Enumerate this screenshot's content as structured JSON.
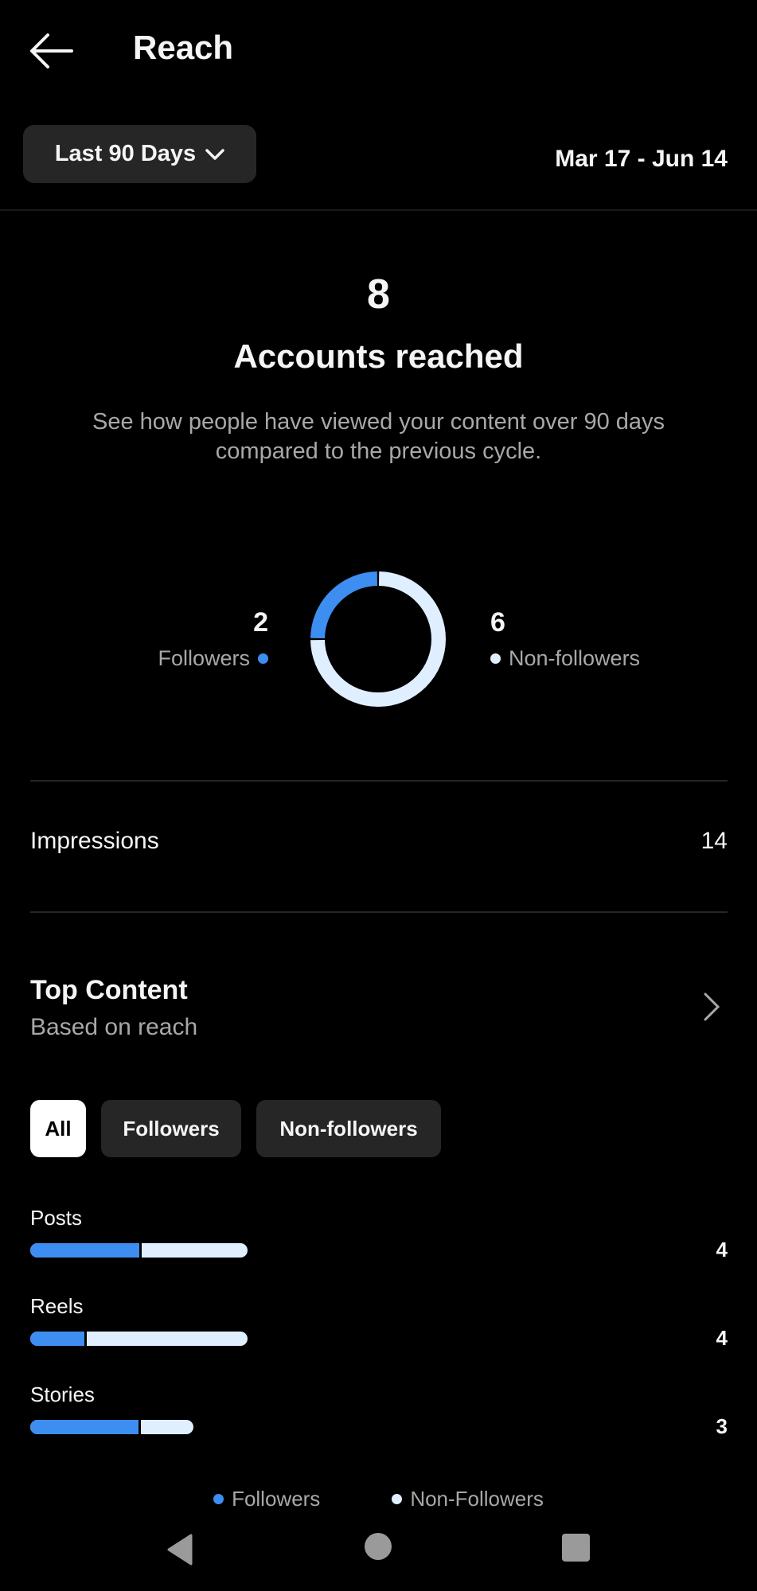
{
  "header": {
    "title": "Reach",
    "back_icon": "arrow-left-icon"
  },
  "filter": {
    "range_label": "Last 90 Days",
    "date_range": "Mar 17 - Jun 14"
  },
  "summary": {
    "total": "8",
    "label": "Accounts reached",
    "description": "See how people have viewed your content over 90 days compared to the previous cycle."
  },
  "colors": {
    "followers": "#3d8ef0",
    "non_followers": "#e0efff",
    "background": "#000000"
  },
  "chart_data": [
    {
      "type": "pie",
      "title": "Accounts reached",
      "categories": [
        "Followers",
        "Non-followers"
      ],
      "values": [
        2,
        6
      ]
    },
    {
      "type": "bar",
      "title": "Top Content",
      "categories": [
        "Posts",
        "Reels",
        "Stories"
      ],
      "series": [
        {
          "name": "Followers",
          "values": [
            2,
            1,
            2
          ]
        },
        {
          "name": "Non-Followers",
          "values": [
            2,
            3,
            1
          ]
        }
      ],
      "totals": [
        4,
        4,
        3
      ],
      "legend": "bottom"
    }
  ],
  "donut": {
    "followers": {
      "value": "2",
      "label": "Followers"
    },
    "non_followers": {
      "value": "6",
      "label": "Non-followers"
    }
  },
  "impressions": {
    "label": "Impressions",
    "value": "14"
  },
  "top_content": {
    "title": "Top Content",
    "subtitle": "Based on reach",
    "tabs": [
      {
        "label": "All",
        "active": true
      },
      {
        "label": "Followers",
        "active": false
      },
      {
        "label": "Non-followers",
        "active": false
      }
    ],
    "rows": [
      {
        "label": "Posts",
        "followers": 2,
        "non_followers": 2,
        "total": "4"
      },
      {
        "label": "Reels",
        "followers": 1,
        "non_followers": 3,
        "total": "4"
      },
      {
        "label": "Stories",
        "followers": 2,
        "non_followers": 1,
        "total": "3"
      }
    ],
    "legend": [
      "Followers",
      "Non-Followers"
    ],
    "max_total": 4
  }
}
